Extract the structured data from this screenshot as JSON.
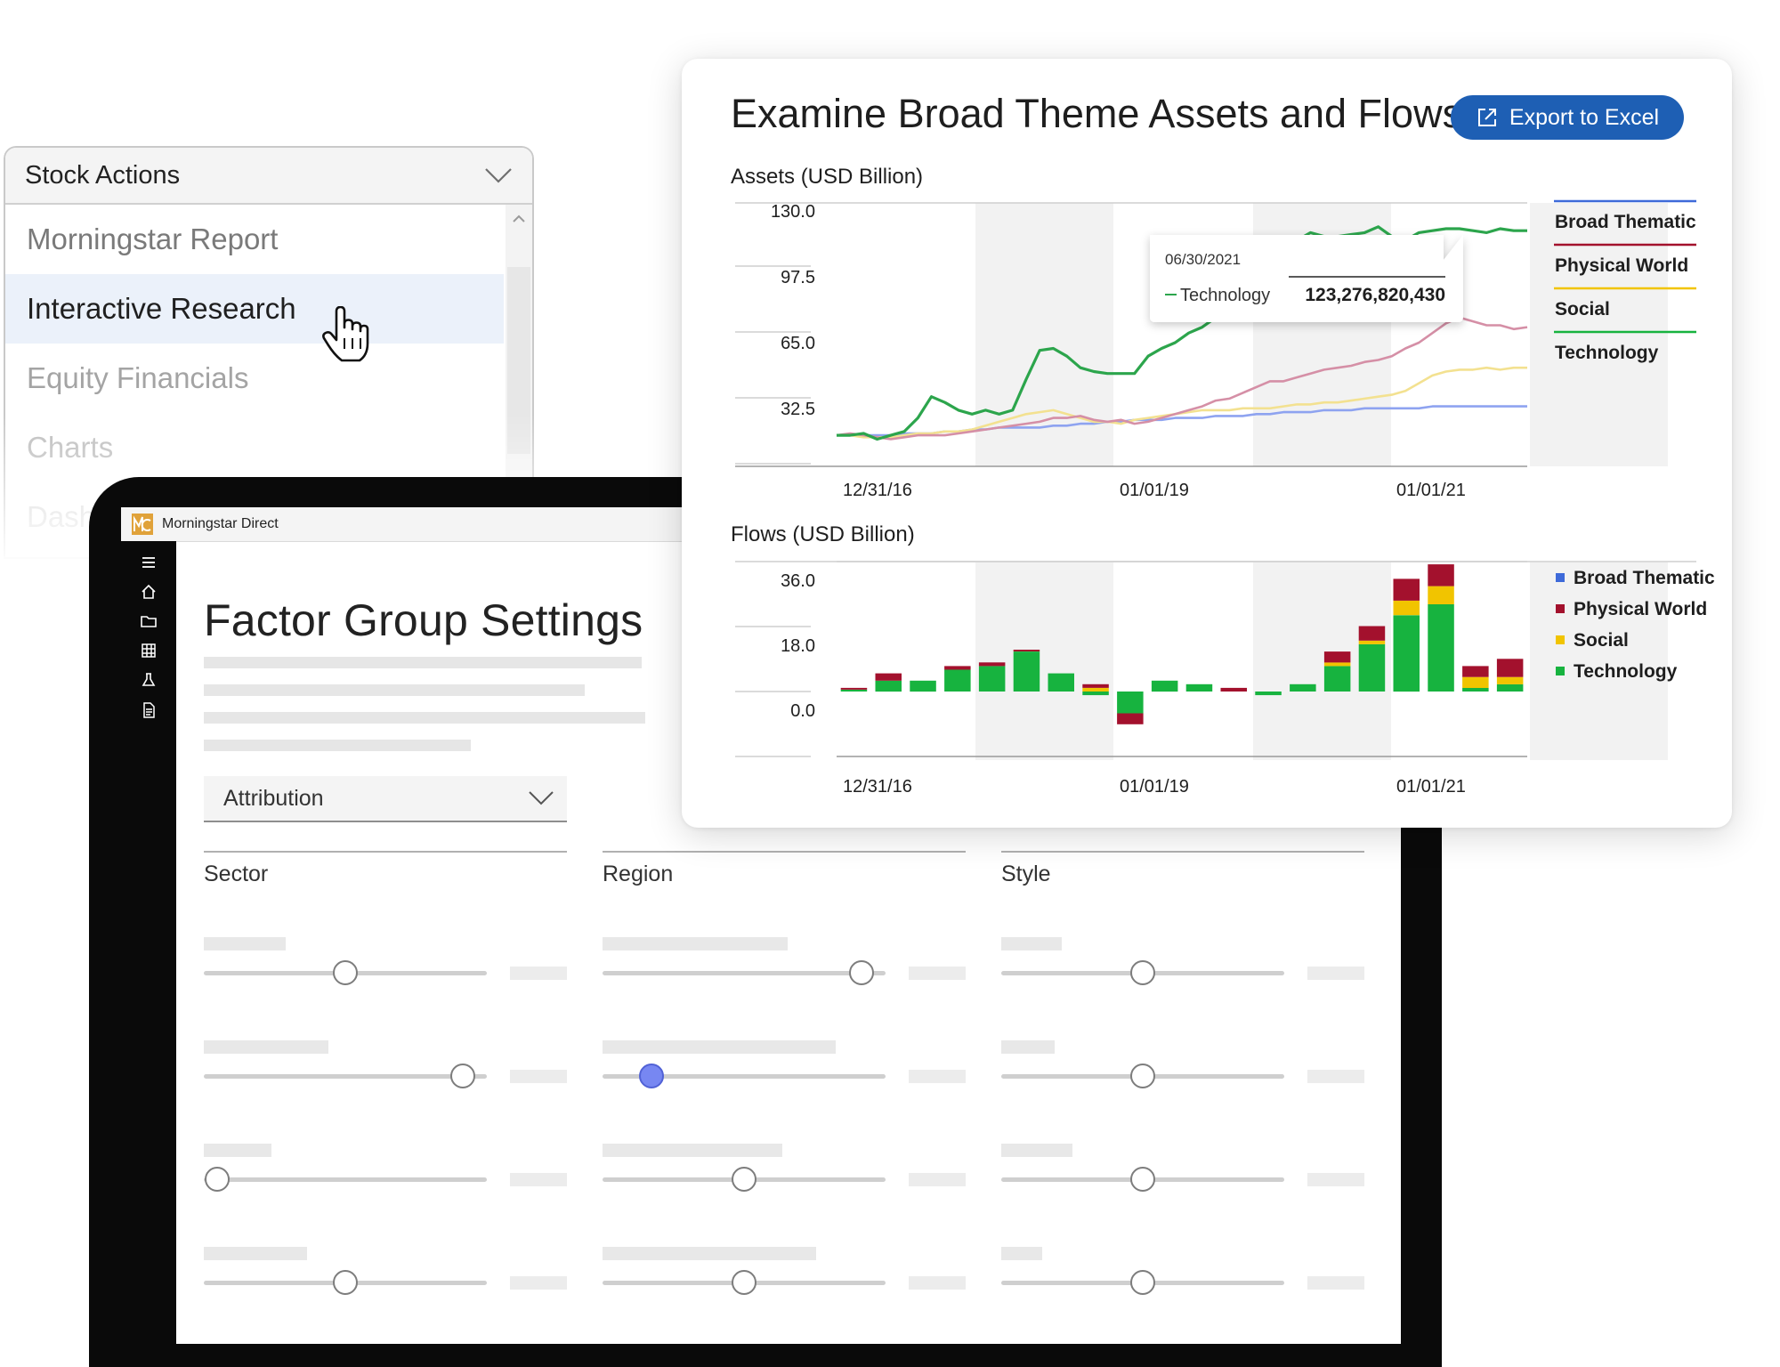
{
  "stock_actions": {
    "title": "Stock Actions",
    "items": [
      "Morningstar Report",
      "Interactive Research",
      "Equity Financials",
      "Charts",
      "Dash"
    ]
  },
  "app": {
    "name": "Morningstar Direct",
    "nav_icons": [
      "menu-icon",
      "home-icon",
      "folder-icon",
      "grid-icon",
      "flask-icon",
      "document-icon"
    ],
    "title": "Factor Group Settings",
    "attribution": "Attribution",
    "columns": [
      "Sector",
      "Region",
      "Style"
    ],
    "slider_values": [
      [
        0.5,
        0.96,
        0.0,
        0.5
      ],
      [
        0.96,
        0.14,
        0.5,
        0.5
      ],
      [
        0.5,
        0.5,
        0.5,
        0.5
      ]
    ]
  },
  "card": {
    "title": "Examine Broad Theme Assets and Flows",
    "export_label": "Export to Excel",
    "colors": {
      "Broad Thematic": "#8ea3f0",
      "Physical World": "#d58fa6",
      "Social": "#f3e190",
      "Technology": "#2ca54c"
    }
  },
  "chart_data": [
    {
      "type": "line",
      "title": "Assets (USD Billion)",
      "ylim": [
        0,
        130
      ],
      "yticks": [
        "130.0",
        "97.5",
        "65.0",
        "32.5"
      ],
      "x_labels": [
        "12/31/16",
        "01/01/19",
        "01/01/21"
      ],
      "legend": [
        "Broad Thematic",
        "Physical World",
        "Social",
        "Technology"
      ],
      "series": [
        {
          "name": "Broad Thematic",
          "values": [
            17,
            17,
            17,
            17,
            17,
            18,
            18,
            18,
            19,
            19,
            20,
            20,
            21,
            21,
            21,
            21,
            22,
            22,
            23,
            23,
            24,
            24,
            25,
            25,
            25,
            26,
            26,
            26,
            27,
            27,
            27,
            28,
            28,
            29,
            29,
            29,
            30,
            30,
            30,
            31,
            31,
            31,
            31,
            31,
            32,
            32,
            32,
            32,
            32,
            32,
            32,
            32
          ]
        },
        {
          "name": "Physical World",
          "values": [
            17,
            18,
            17,
            16,
            15,
            16,
            17,
            17,
            17,
            18,
            19,
            20,
            21,
            22,
            23,
            24,
            26,
            26,
            27,
            25,
            24,
            25,
            23,
            24,
            26,
            28,
            30,
            32,
            35,
            36,
            39,
            42,
            45,
            45,
            47,
            49,
            51,
            52,
            53,
            55,
            56,
            58,
            62,
            65,
            70,
            75,
            78,
            76,
            74,
            74,
            72,
            73
          ]
        },
        {
          "name": "Social",
          "values": [
            17,
            17,
            16,
            16,
            16,
            17,
            18,
            18,
            19,
            19,
            20,
            22,
            24,
            26,
            28,
            29,
            30,
            28,
            26,
            24,
            24,
            23,
            25,
            26,
            27,
            28,
            29,
            30,
            30,
            30,
            31,
            31,
            31,
            32,
            33,
            33,
            34,
            34,
            35,
            36,
            37,
            38,
            40,
            44,
            48,
            50,
            51,
            51,
            52,
            51,
            52,
            52
          ]
        },
        {
          "name": "Technology",
          "values": [
            17,
            17,
            18,
            15,
            17,
            19,
            26,
            37,
            34,
            30,
            28,
            30,
            28,
            30,
            46,
            61,
            62,
            58,
            52,
            50,
            49,
            49,
            49,
            58,
            62,
            65,
            70,
            73,
            78,
            81,
            84,
            92,
            100,
            110,
            118,
            122,
            120,
            120,
            121,
            122,
            125,
            120,
            118,
            122,
            123,
            124,
            124,
            123,
            122,
            124,
            123,
            123
          ]
        }
      ],
      "tooltip": {
        "date": "06/30/2021",
        "series": "Technology",
        "value": "123,276,820,430"
      }
    },
    {
      "type": "bar",
      "title": "Flows (USD Billion)",
      "ylim": [
        -18,
        36
      ],
      "yticks": [
        "36.0",
        "18.0",
        "0.0"
      ],
      "x_labels": [
        "12/31/16",
        "01/01/19",
        "01/01/21"
      ],
      "legend": [
        "Broad Thematic",
        "Physical World",
        "Social",
        "Technology"
      ],
      "legend_colors": [
        "#3e6ad9",
        "#a3112d",
        "#f1c400",
        "#17b33f"
      ],
      "series": [
        {
          "name": "Technology",
          "values": [
            0.5,
            3,
            3,
            6,
            7,
            11,
            5,
            -1,
            -6,
            3,
            2,
            0,
            -1,
            2,
            7,
            13,
            21,
            24,
            1,
            2
          ]
        },
        {
          "name": "Social",
          "values": [
            0,
            0,
            0,
            0,
            0,
            0,
            0,
            1,
            0,
            0,
            0,
            0,
            0,
            0,
            1,
            1,
            4,
            5,
            3,
            2
          ]
        },
        {
          "name": "Physical World",
          "values": [
            0.5,
            2,
            0,
            1,
            1,
            0.5,
            0,
            1,
            -3,
            0,
            0,
            1,
            0,
            0,
            3,
            4,
            6,
            6,
            3,
            5
          ]
        },
        {
          "name": "Broad Thematic",
          "values": [
            0,
            0,
            0,
            0,
            0,
            0,
            0,
            0,
            0,
            0,
            0,
            0,
            0,
            0,
            0,
            0,
            0,
            0,
            0,
            0
          ]
        }
      ]
    }
  ]
}
